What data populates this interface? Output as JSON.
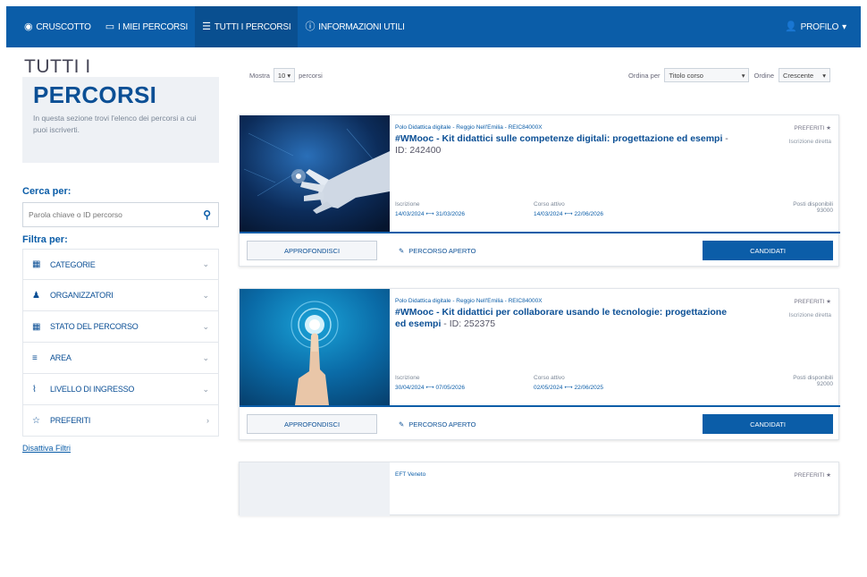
{
  "nav": {
    "items": [
      {
        "icon": "dashboard-icon",
        "glyph": "◉",
        "label": "CRUSCOTTO"
      },
      {
        "icon": "monitor-icon",
        "glyph": "▭",
        "label": "I MIEI PERCORSI"
      },
      {
        "icon": "list-icon",
        "glyph": "☰",
        "label": "TUTTI I PERCORSI"
      },
      {
        "icon": "info-icon",
        "glyph": "ⓘ",
        "label": "INFORMAZIONI UTILI"
      }
    ],
    "profile": {
      "glyph": "👤",
      "label": "PROFILO",
      "caret": "▾"
    }
  },
  "sidebar": {
    "title_line1": "TUTTI I",
    "title_line2": "PERCORSI",
    "description": "In questa sezione trovi l'elenco dei percorsi a cui puoi iscriverti.",
    "search_heading": "Cerca per:",
    "search_placeholder": "Parola chiave o ID percorso",
    "filter_heading": "Filtra per:",
    "filters": [
      {
        "icon": "grid-icon",
        "glyph": "▦",
        "label": "CATEGORIE",
        "chevron": "⌄"
      },
      {
        "icon": "user-icon",
        "glyph": "♟",
        "label": "ORGANIZZATORI",
        "chevron": "⌄"
      },
      {
        "icon": "grid-icon",
        "glyph": "▦",
        "label": "STATO DEL PERCORSO",
        "chevron": "⌄"
      },
      {
        "icon": "sliders-icon",
        "glyph": "≡",
        "label": "AREA",
        "chevron": "⌄"
      },
      {
        "icon": "stairs-icon",
        "glyph": "⌇",
        "label": "LIVELLO DI INGRESSO",
        "chevron": "⌄"
      },
      {
        "icon": "star-icon",
        "glyph": "☆",
        "label": "PREFERITI",
        "chevron": "›"
      }
    ],
    "reset_label": "Disattiva Filtri"
  },
  "toolbar": {
    "mostra": "Mostra",
    "per_page": "10",
    "percorsi": "percorsi",
    "ordina_per": "Ordina per",
    "sort_field": "Titolo corso",
    "ordine": "Ordine",
    "sort_order": "Crescente"
  },
  "cards": [
    {
      "organizer": "Polo Didattica digitale - Reggio Nell'Emilia - REIC84000X",
      "title": "#WMooc - Kit didattici sulle competenze digitali: progettazione ed esempi",
      "id_text": " - ID: 242400",
      "preferiti": "PREFERITI",
      "nota": "Iscrizione diretta",
      "iscrizione_label": "Iscrizione",
      "iscrizione_value": "14/03/2024 ⟷ 31/03/2026",
      "corso_label": "Corso attivo",
      "corso_value": "14/03/2024 ⟷ 22/06/2026",
      "posti_label": "Posti disponibili",
      "posti_value": "93000",
      "approfondisci": "APPROFONDISCI",
      "stato": "PERCORSO APERTO",
      "candidati": "CANDIDATI"
    },
    {
      "organizer": "Polo Didattica digitale - Reggio Nell'Emilia - REIC84000X",
      "title": "#WMooc - Kit didattici per collaborare usando le tecnologie: progettazione ed esempi",
      "id_text": " - ID: 252375",
      "preferiti": "PREFERITI",
      "nota": "Iscrizione diretta",
      "iscrizione_label": "Iscrizione",
      "iscrizione_value": "30/04/2024 ⟷ 07/05/2026",
      "corso_label": "Corso attivo",
      "corso_value": "02/05/2024 ⟷ 22/06/2025",
      "posti_label": "Posti disponibili",
      "posti_value": "92000",
      "approfondisci": "APPROFONDISCI",
      "stato": "PERCORSO APERTO",
      "candidati": "CANDIDATI"
    },
    {
      "organizer": "EFT Veneto",
      "preferiti": "PREFERITI"
    }
  ]
}
